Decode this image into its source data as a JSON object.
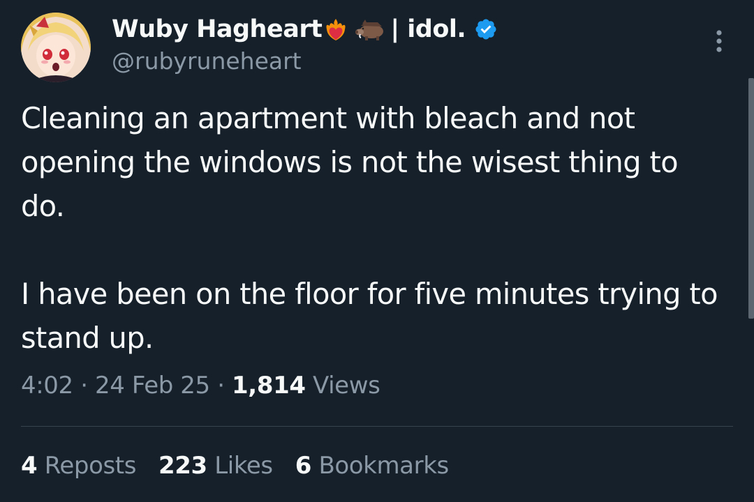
{
  "author": {
    "display_name": "Wuby Hagheart",
    "name_suffix": "| idol.",
    "name_emojis": [
      "heart-on-fire",
      "boar"
    ],
    "handle": "@rubyruneheart",
    "verified": true
  },
  "tweet": {
    "paragraphs": [
      "Cleaning an apartment with bleach and not opening the windows is not the wisest thing to do.",
      "I have been on the floor for five minutes trying to stand up."
    ]
  },
  "meta": {
    "time": "4:02",
    "separator": "·",
    "date": "24 Feb 25",
    "views_count": "1,814",
    "views_label": "Views"
  },
  "stats": {
    "reposts": {
      "count": "4",
      "label": "Reposts"
    },
    "likes": {
      "count": "223",
      "label": "Likes"
    },
    "bookmarks": {
      "count": "6",
      "label": "Bookmarks"
    }
  },
  "colors": {
    "background": "#15202b",
    "text": "#f7f9f9",
    "secondary": "#8b98a5",
    "divider": "#38444d",
    "verified": "#1d9bf0"
  },
  "icons": {
    "more": "more-vertical-icon",
    "verified": "verified-badge-icon"
  }
}
